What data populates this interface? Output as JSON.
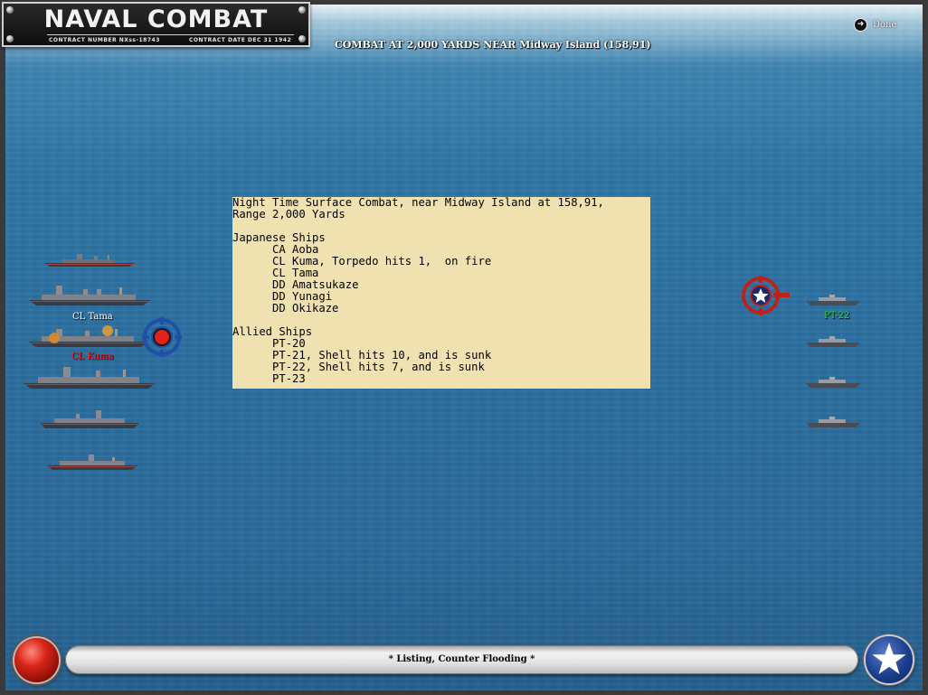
{
  "title_plate": {
    "title": "NAVAL COMBAT",
    "contract_number": "CONTRACT NUMBER  NXss-18743",
    "contract_date": "CONTRACT DATE  DEC 31  1942"
  },
  "heading": "COMBAT AT 2,000 YARDS NEAR Midway Island (158,91)",
  "done_label": "Done",
  "report_lines": [
    "Night Time Surface Combat, near Midway Island at 158,91,",
    "Range 2,000 Yards",
    "",
    "Japanese Ships",
    "      CA Aoba",
    "      CL Kuma, Torpedo hits 1,  on fire",
    "      CL Tama",
    "      DD Amatsukaze",
    "      DD Yunagi",
    "      DD Okikaze",
    "",
    "Allied Ships",
    "      PT-20",
    "      PT-21, Shell hits 10, and is sunk",
    "      PT-22, Shell hits 7, and is sunk",
    "      PT-23"
  ],
  "ship_labels": {
    "tama": "CL Tama",
    "kuma": "CL Kuma",
    "pt": "PT-22"
  },
  "colors": {
    "label_white": "#ffffff",
    "label_red": "#ff1a1a",
    "label_green": "#22dd22",
    "report_bg": "#efe2b0"
  },
  "status_text": "* Listing, Counter Flooding *"
}
